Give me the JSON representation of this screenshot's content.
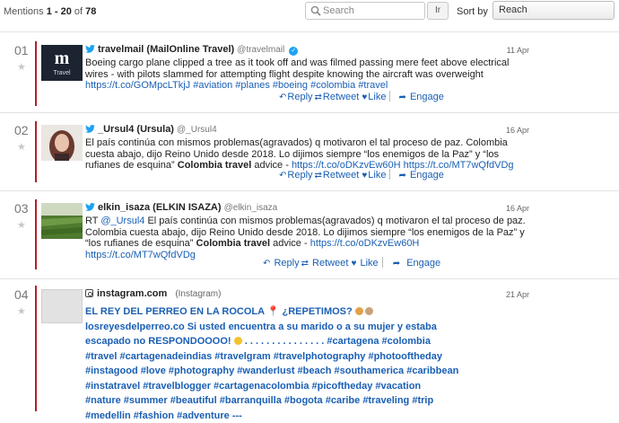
{
  "toolbar": {
    "mentions_prefix": "Mentions",
    "range": "1 - 20",
    "of_label": "of",
    "total": "78",
    "search_placeholder": "Search",
    "search_button": "Ir",
    "sort_label": "Sort by",
    "sort_value": "Reach"
  },
  "actions": {
    "reply": "Reply",
    "retweet": "Retweet",
    "like": "Like",
    "engage": "Engage"
  },
  "mentions": [
    {
      "num": "01",
      "name": "travelmail (MailOnline Travel)",
      "handle": "@travelmail",
      "verified": true,
      "date": "11 Apr",
      "avatar_text": "Travel",
      "text": "Boeing cargo plane clipped a tree as it took off and was filmed passing mere feet above electrical wires - with pilots slammed for attempting flight despite knowing the aircraft was overweight",
      "links": "https://t.co/GOMpcLTkjJ #aviation #planes #boeing #colombia #travel"
    },
    {
      "num": "02",
      "name": "_Ursul4 (Ursula)",
      "handle": "@_Ursul4",
      "date": "16 Apr",
      "text": "El país continúa con mismos problemas(agravados) q motivaron el tal proceso de paz. Colombia cuesta abajo, dijo Reino Unido desde 2018. Lo dijimos siempre “los enemigos de la Paz” y “los rufianes de esquina”",
      "bold": "Colombia travel",
      "text2": "advice -",
      "links": "https://t.co/oDKzvEw60H https://t.co/MT7wQfdVDg"
    },
    {
      "num": "03",
      "name": "elkin_isaza (ELKIN ISAZA)",
      "handle": "@elkin_isaza",
      "date": "16 Apr",
      "prefix": "RT",
      "mention": "@_Ursul4",
      "text": "El país continúa con mismos problemas(agravados) q motivaron el tal proceso de paz. Colombia cuesta abajo, dijo Reino Unido desde 2018. Lo dijimos siempre “los enemigos de la Paz” y “los rufianes de esquina”",
      "bold": "Colombia travel",
      "text2": "advice -",
      "link1": "https://t.co/oDKzvEw60H",
      "link2": "https://t.co/MT7wQfdVDg"
    },
    {
      "num": "04",
      "name": "instagram.com",
      "source": "(Instagram)",
      "date": "21 Apr",
      "title": "EL REY DEL PERREO EN LA ROCOLA",
      "title2": "¿REPETIMOS?",
      "line2": "losreyesdelperreo.co Si usted encuentra a su marido o a su mujer y estaba",
      "line3a": "escapado no RESPONDOOOO!",
      "line3b": ". . . . . . . . . . . . . . . #cartagena #colombia",
      "line4": "#travel #cartagenadeindias #travelgram #travelphotography #photooftheday",
      "line5": "#instagood #love #photography #wanderlust #beach #southamerica #caribbean",
      "line6": "#instatravel #travelblogger #cartagenacolombia #picoftheday #vacation",
      "line7": "#nature #summer #beautiful #barranquilla #bogota #caribe #traveling #trip",
      "line8": "#medellin #fashion #adventure ---"
    }
  ]
}
